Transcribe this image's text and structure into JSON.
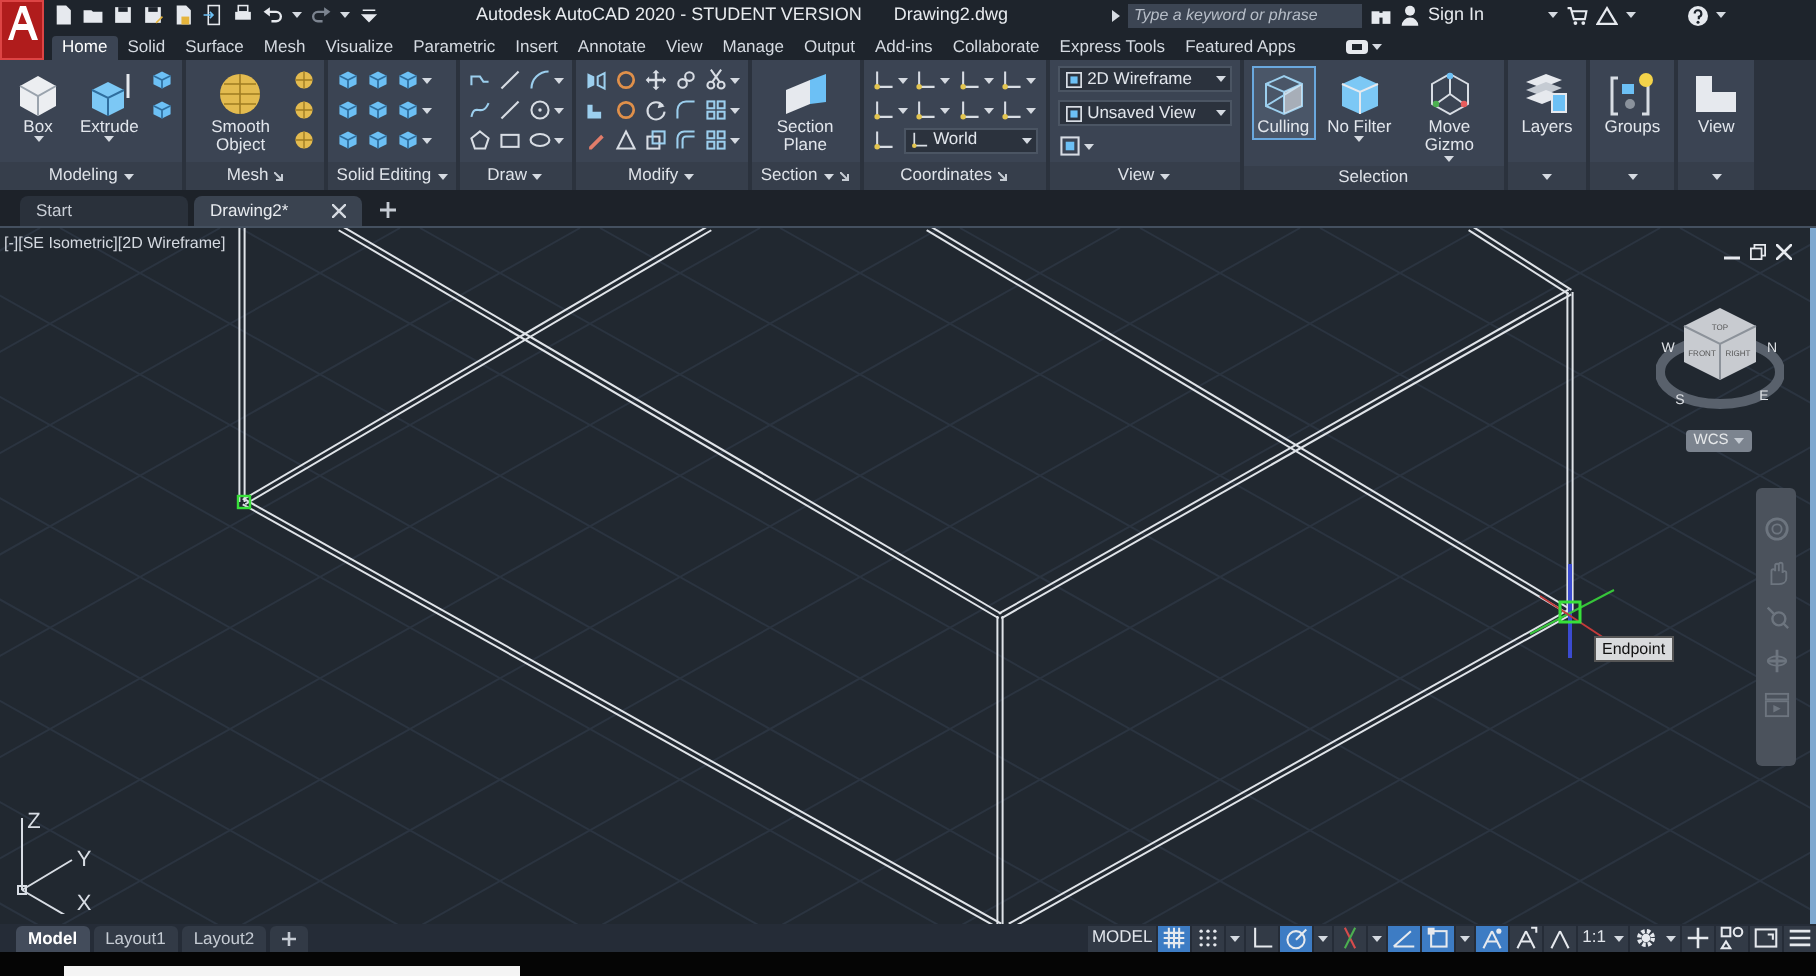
{
  "title_bar": {
    "app_title": "Autodesk AutoCAD 2020 - STUDENT VERSION",
    "file_name": "Drawing2.dwg",
    "search": {
      "placeholder": "Type a keyword or phrase"
    },
    "sign_in": "Sign In"
  },
  "ribbon_tabs": [
    {
      "label": "Home",
      "selected": true
    },
    {
      "label": "Solid",
      "selected": false
    },
    {
      "label": "Surface",
      "selected": false
    },
    {
      "label": "Mesh",
      "selected": false
    },
    {
      "label": "Visualize",
      "selected": false
    },
    {
      "label": "Parametric",
      "selected": false
    },
    {
      "label": "Insert",
      "selected": false
    },
    {
      "label": "Annotate",
      "selected": false
    },
    {
      "label": "View",
      "selected": false
    },
    {
      "label": "Manage",
      "selected": false
    },
    {
      "label": "Output",
      "selected": false
    },
    {
      "label": "Add-ins",
      "selected": false
    },
    {
      "label": "Collaborate",
      "selected": false
    },
    {
      "label": "Express Tools",
      "selected": false
    },
    {
      "label": "Featured Apps",
      "selected": false
    }
  ],
  "ribbon_panels": [
    {
      "label": "Modeling",
      "buttons": [
        {
          "label": "Box",
          "selected": false
        },
        {
          "label": "Extrude",
          "selected": false
        }
      ]
    },
    {
      "label": "Mesh",
      "buttons": [
        {
          "label": "Smooth Object",
          "selected": false
        }
      ]
    },
    {
      "label": "Solid Editing"
    },
    {
      "label": "Draw"
    },
    {
      "label": "Modify"
    },
    {
      "label": "Section",
      "buttons": [
        {
          "label": "Section Plane",
          "selected": false
        }
      ]
    },
    {
      "label": "Coordinates",
      "dropdowns": [
        {
          "value": "World"
        }
      ]
    },
    {
      "label": "View",
      "dropdowns": [
        {
          "value": "2D Wireframe"
        },
        {
          "value": "Unsaved View"
        }
      ]
    },
    {
      "label": "Selection",
      "buttons": [
        {
          "label": "Culling",
          "selected": true
        },
        {
          "label": "No Filter",
          "selected": false
        },
        {
          "label": "Move Gizmo",
          "selected": false
        }
      ]
    },
    {
      "buttons": [
        {
          "label": "Layers",
          "selected": false
        }
      ]
    },
    {
      "buttons": [
        {
          "label": "Groups",
          "selected": false
        }
      ]
    },
    {
      "buttons": [
        {
          "label": "View",
          "selected": false
        }
      ]
    }
  ],
  "file_tabs": [
    {
      "label": "Start",
      "selected": false
    },
    {
      "label": "Drawing2*",
      "selected": true
    }
  ],
  "viewport": {
    "label": "[-][SE Isometric][2D Wireframe]",
    "view_cube": {
      "faces": [
        "TOP",
        "FRONT",
        "RIGHT"
      ],
      "compass": [
        "W",
        "N",
        "S",
        "E"
      ],
      "ucs_menu": "WCS"
    },
    "tooltip": "Endpoint",
    "ucs_axes": [
      "Z",
      "Y",
      "X"
    ]
  },
  "layout_tabs": [
    {
      "label": "Model",
      "selected": true
    },
    {
      "label": "Layout1",
      "selected": false
    },
    {
      "label": "Layout2",
      "selected": false
    }
  ],
  "status_bar": {
    "mode": "MODEL",
    "scale": "1:1",
    "toggles": [
      {
        "kind": "grid",
        "on": true
      },
      {
        "kind": "snap",
        "on": false
      },
      {
        "kind": "ortho",
        "on": false
      },
      {
        "kind": "polar",
        "on": true
      },
      {
        "kind": "isodraft",
        "on": false
      },
      {
        "kind": "tracking",
        "on": true
      },
      {
        "kind": "osnap",
        "on": true
      },
      {
        "kind": "annotation_visibility",
        "on": true
      },
      {
        "kind": "autoscale",
        "on": false
      }
    ]
  }
}
